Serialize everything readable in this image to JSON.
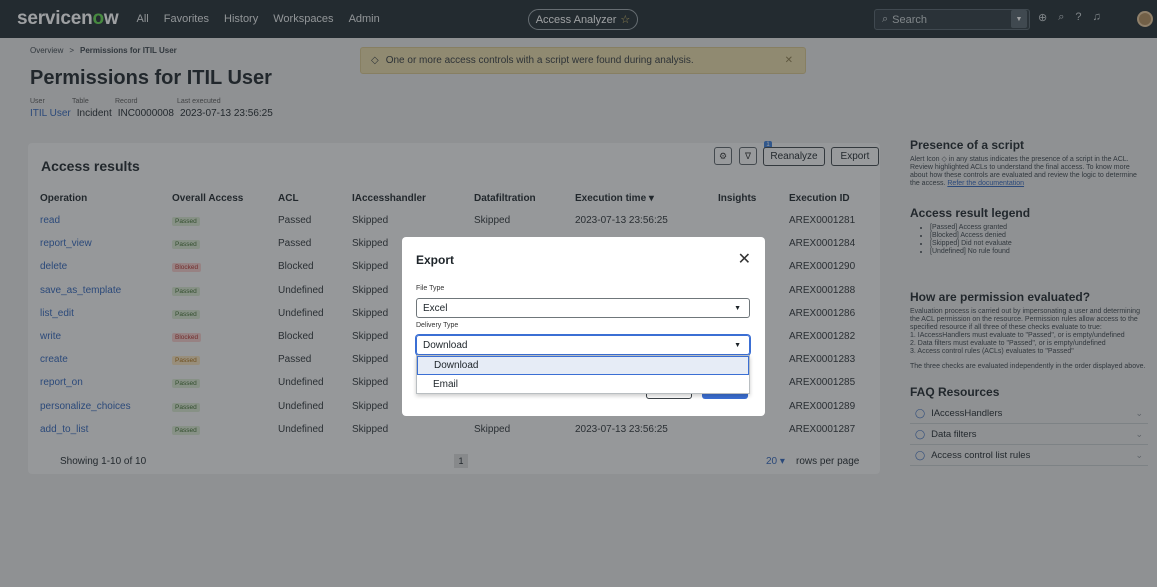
{
  "topbar": {
    "logo_main": "servicen",
    "logo_o": "o",
    "logo_end": "w",
    "nav": [
      "All",
      "Favorites",
      "History",
      "Workspaces",
      "Admin"
    ],
    "analyzer": "Access Analyzer",
    "search_placeholder": "Search"
  },
  "breadcrumb": {
    "root": "Overview",
    "current": "Permissions for ITIL User"
  },
  "page": {
    "title": "Permissions for ITIL User",
    "meta_labels": [
      "User",
      "Table",
      "Record",
      "Last executed"
    ],
    "user": "ITIL User",
    "table": "Incident",
    "record": "INC0000008",
    "executed": "2023-07-13 23:56:25"
  },
  "banner": {
    "text": "One or more access controls with a script were found during analysis."
  },
  "results": {
    "title": "Access results",
    "filter_count": "1",
    "reanalyze": "Reanalyze",
    "export": "Export",
    "columns": [
      "Operation",
      "Overall Access",
      "ACL",
      "IAccesshandler",
      "Datafiltration",
      "Execution time ▾",
      "Insights",
      "Execution ID"
    ],
    "rows": [
      {
        "op": "read",
        "status": "Passed",
        "type": "pass",
        "acl": "Passed",
        "handler": "Skipped",
        "filter": "Skipped",
        "time": "2023-07-13 23:56:25",
        "id": "AREX0001281"
      },
      {
        "op": "report_view",
        "status": "Passed",
        "type": "pass",
        "acl": "Passed",
        "handler": "Skipped",
        "filter": "",
        "time": "",
        "id": "AREX0001284"
      },
      {
        "op": "delete",
        "status": "Blocked",
        "type": "block",
        "acl": "Blocked",
        "handler": "Skipped",
        "filter": "",
        "time": "",
        "id": "AREX0001290"
      },
      {
        "op": "save_as_template",
        "status": "Passed",
        "type": "pass",
        "acl": "Undefined",
        "handler": "Skipped",
        "filter": "",
        "time": "",
        "id": "AREX0001288"
      },
      {
        "op": "list_edit",
        "status": "Passed",
        "type": "pass",
        "acl": "Undefined",
        "handler": "Skipped",
        "filter": "",
        "time": "",
        "id": "AREX0001286"
      },
      {
        "op": "write",
        "status": "Blocked",
        "type": "block",
        "acl": "Blocked",
        "handler": "Skipped",
        "filter": "",
        "time": "",
        "id": "AREX0001282"
      },
      {
        "op": "create",
        "status": "Passed",
        "type": "warn",
        "acl": "Passed",
        "handler": "Skipped",
        "filter": "",
        "time": "",
        "id": "AREX0001283"
      },
      {
        "op": "report_on",
        "status": "Passed",
        "type": "pass",
        "acl": "Undefined",
        "handler": "Skipped",
        "filter": "",
        "time": "",
        "id": "AREX0001285"
      },
      {
        "op": "personalize_choices",
        "status": "Passed",
        "type": "pass",
        "acl": "Undefined",
        "handler": "Skipped",
        "filter": "",
        "time": "",
        "id": "AREX0001289"
      },
      {
        "op": "add_to_list",
        "status": "Passed",
        "type": "pass",
        "acl": "Undefined",
        "handler": "Skipped",
        "filter": "Skipped",
        "time": "2023-07-13 23:56:25",
        "id": "AREX0001287"
      }
    ],
    "showing": "Showing 1-10 of 10",
    "page": "1",
    "per_page": "20 ▾",
    "rows_per_page": "rows per page"
  },
  "sidebar": {
    "script_title": "Presence of a script",
    "script_text": "Alert Icon ◇ in any status indicates the presence of a script in the ACL. Review highlighted ACLs to understand the final access. To know more about how these controls are evaluated and review the logic to determine the access.",
    "doc_link": "Refer the documentation",
    "legend_title": "Access result legend",
    "legend": [
      "[Passed] Access granted",
      "[Blocked] Access denied",
      "[Skipped] Did not evaluate",
      "[Undefined] No rule found"
    ],
    "perm_title": "How are permission evaluated?",
    "perm_text": "Evaluation process is carried out by impersonating a user and determining the ACL permission on the resource. Permission rules allow access to the specified resource if all three of these checks evaluate to true:",
    "perm_list": [
      "1. IAccessHandlers must evaluate to \"Passed\", or is empty/undefined",
      "2. Data filters must evaluate to \"Passed\", or is empty/undefined",
      "3. Access control rules (ACLs) evaluates to \"Passed\""
    ],
    "perm_note": "The three checks are evaluated independently in the order displayed above.",
    "faq_title": "FAQ Resources",
    "faq": [
      "IAccessHandlers",
      "Data filters",
      "Access control list rules"
    ]
  },
  "modal": {
    "title": "Export",
    "file_type_label": "File Type",
    "file_type": "Excel",
    "delivery_label": "Delivery Type",
    "delivery": "Download",
    "options": [
      "Download",
      "Email"
    ],
    "cancel": "Cancel",
    "export": "Export"
  }
}
